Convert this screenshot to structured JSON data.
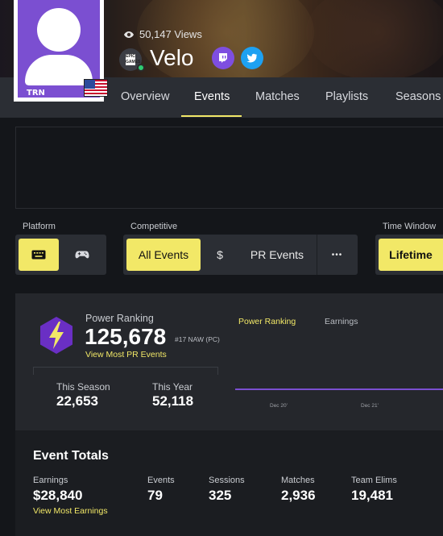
{
  "profile": {
    "views": "50,147 Views",
    "name": "Velo",
    "avatar_badge": "TRN",
    "platform_icon": "epic-games-icon",
    "country_flag": "us-flag-icon",
    "socials": [
      "twitch-icon",
      "twitter-icon"
    ]
  },
  "nav": {
    "tabs": [
      "Overview",
      "Events",
      "Matches",
      "Playlists",
      "Seasons"
    ],
    "active": "Events"
  },
  "filters": {
    "platform_label": "Platform",
    "platform_options": [
      "keyboard-icon",
      "gamepad-icon"
    ],
    "competitive_label": "Competitive",
    "all_events": "All Events",
    "dollar": "$",
    "pr_events": "PR Events",
    "more": "•••",
    "time_window_label": "Time Window",
    "lifetime": "Lifetime"
  },
  "power_ranking": {
    "label": "Power Ranking",
    "value": "125,678",
    "rank": "#17 NAW (PC)",
    "link": "View Most PR Events",
    "this_season_label": "This Season",
    "this_season_value": "22,653",
    "this_year_label": "This Year",
    "this_year_value": "52,118"
  },
  "chart": {
    "tab_active": "Power Ranking",
    "tab_other": "Earnings",
    "ticks": [
      "Dec 20'",
      "Dec 21'"
    ]
  },
  "event_totals": {
    "title": "Event Totals",
    "earnings_label": "Earnings",
    "earnings_value": "$28,840",
    "earnings_link": "View Most Earnings",
    "events_label": "Events",
    "events_value": "79",
    "sessions_label": "Sessions",
    "sessions_value": "325",
    "matches_label": "Matches",
    "matches_value": "2,936",
    "team_elims_label": "Team Elims",
    "team_elims_value": "19,481"
  },
  "colors": {
    "accent": "#f2e867",
    "purple": "#7b4fd1",
    "twitch": "#7e4ee0",
    "twitter": "#1da1f2"
  }
}
